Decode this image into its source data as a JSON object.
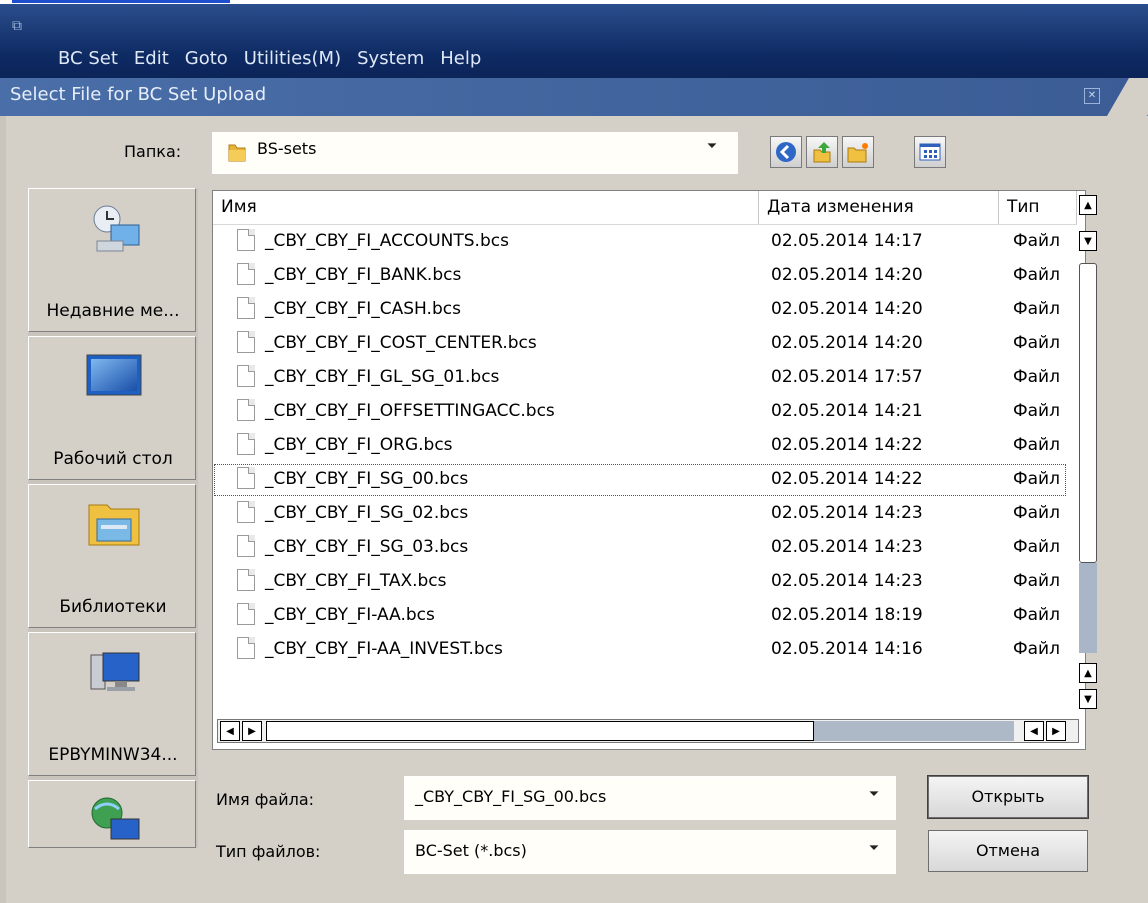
{
  "window": {
    "menus": [
      "BC Set",
      "Edit",
      "Goto",
      "Utilities(M)",
      "System",
      "Help"
    ],
    "dialog_title": "Select File for BC Set Upload",
    "close_glyph": "✕"
  },
  "folder": {
    "label": "Папка:",
    "value": "BS-sets"
  },
  "places": [
    {
      "label": "Недавние ме...",
      "icon": "recent-places-icon"
    },
    {
      "label": "Рабочий стол",
      "icon": "desktop-icon"
    },
    {
      "label": "Библиотеки",
      "icon": "libraries-icon"
    },
    {
      "label": "EPBYMINW34...",
      "icon": "computer-icon"
    },
    {
      "label": "",
      "icon": "network-icon"
    }
  ],
  "columns": [
    "Имя",
    "Дата изменения",
    "Тип"
  ],
  "files": [
    {
      "name": "_CBY_CBY_FI_ACCOUNTS.bcs",
      "date": "02.05.2014 14:17",
      "type": "Файл"
    },
    {
      "name": "_CBY_CBY_FI_BANK.bcs",
      "date": "02.05.2014 14:20",
      "type": "Файл"
    },
    {
      "name": "_CBY_CBY_FI_CASH.bcs",
      "date": "02.05.2014 14:20",
      "type": "Файл"
    },
    {
      "name": "_CBY_CBY_FI_COST_CENTER.bcs",
      "date": "02.05.2014 14:20",
      "type": "Файл"
    },
    {
      "name": "_CBY_CBY_FI_GL_SG_01.bcs",
      "date": "02.05.2014 17:57",
      "type": "Файл"
    },
    {
      "name": "_CBY_CBY_FI_OFFSETTINGACC.bcs",
      "date": "02.05.2014 14:21",
      "type": "Файл"
    },
    {
      "name": "_CBY_CBY_FI_ORG.bcs",
      "date": "02.05.2014 14:22",
      "type": "Файл"
    },
    {
      "name": "_CBY_CBY_FI_SG_00.bcs",
      "date": "02.05.2014 14:22",
      "type": "Файл",
      "selected": true
    },
    {
      "name": "_CBY_CBY_FI_SG_02.bcs",
      "date": "02.05.2014 14:23",
      "type": "Файл"
    },
    {
      "name": "_CBY_CBY_FI_SG_03.bcs",
      "date": "02.05.2014 14:23",
      "type": "Файл"
    },
    {
      "name": "_CBY_CBY_FI_TAX.bcs",
      "date": "02.05.2014 14:23",
      "type": "Файл"
    },
    {
      "name": "_CBY_CBY_FI-AA.bcs",
      "date": "02.05.2014 18:19",
      "type": "Файл"
    },
    {
      "name": "_CBY_CBY_FI-AA_INVEST.bcs",
      "date": "02.05.2014 14:16",
      "type": "Файл"
    }
  ],
  "filename": {
    "label": "Имя файла:",
    "value": "_CBY_CBY_FI_SG_00.bcs"
  },
  "filetype": {
    "label": "Тип файлов:",
    "value": "BC-Set (*.bcs)"
  },
  "buttons": {
    "open": "Открыть",
    "cancel": "Отмена"
  }
}
